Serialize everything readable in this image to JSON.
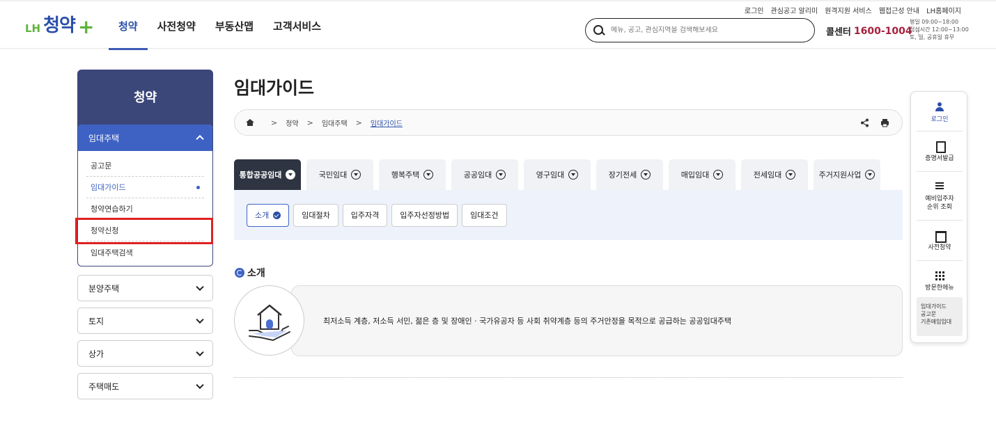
{
  "util_links": [
    "로그인",
    "관심공고 알리미",
    "원격지원 서비스",
    "웹접근성 안내",
    "LH홈페이지"
  ],
  "logo": {
    "prefix": "LH",
    "brand": "청약",
    "plus": "+"
  },
  "gnb": [
    {
      "label": "청약",
      "active": true
    },
    {
      "label": "사전청약"
    },
    {
      "label": "부동산맵"
    },
    {
      "label": "고객서비스"
    }
  ],
  "search": {
    "placeholder": "메뉴, 공고, 관심지역을 검색해보세요"
  },
  "callcenter": {
    "label": "콜센터",
    "number": "1600-1004"
  },
  "hours": [
    "평일 09:00~18:00",
    "점심시간 12:00~13:00",
    "토, 일, 공휴일 휴무"
  ],
  "lnb": {
    "title": "청약",
    "group": {
      "label": "임대주택",
      "items": [
        "공고문",
        "임대가이드",
        "청약연습하기",
        "청약신청",
        "임대주택검색"
      ]
    },
    "others": [
      "분양주택",
      "토지",
      "상가",
      "주택매도"
    ]
  },
  "page_title": "임대가이드",
  "breadcrumb": [
    "청약",
    "임대주택",
    "임대가이드"
  ],
  "tabs": [
    "통합공공임대",
    "국민임대",
    "행복주택",
    "공공임대",
    "영구임대",
    "장기전세",
    "매입임대",
    "전세임대",
    "주거지원사업"
  ],
  "subtabs": [
    "소개",
    "임대절차",
    "입주자격",
    "입주자선정방법",
    "임대조건"
  ],
  "section_title": "소개",
  "intro_text": "최저소득 계층, 저소득 서민, 젊은 층 및 장애인 · 국가유공자 등 사회 취약계층 등의 주거안정을 목적으로 공급하는 공공임대주택",
  "quick_menu": [
    "로그인",
    "증명서발급",
    "예비입주자\n순위 조회",
    "사전청약",
    "방문한메뉴"
  ],
  "visited": [
    "임대가이드",
    "공고문",
    "기존매입임대"
  ],
  "colors": {
    "primary": "#3e62c4",
    "lnb_title": "#3b4679",
    "highlight": "#e02020",
    "callcenter": "#a6203e"
  }
}
